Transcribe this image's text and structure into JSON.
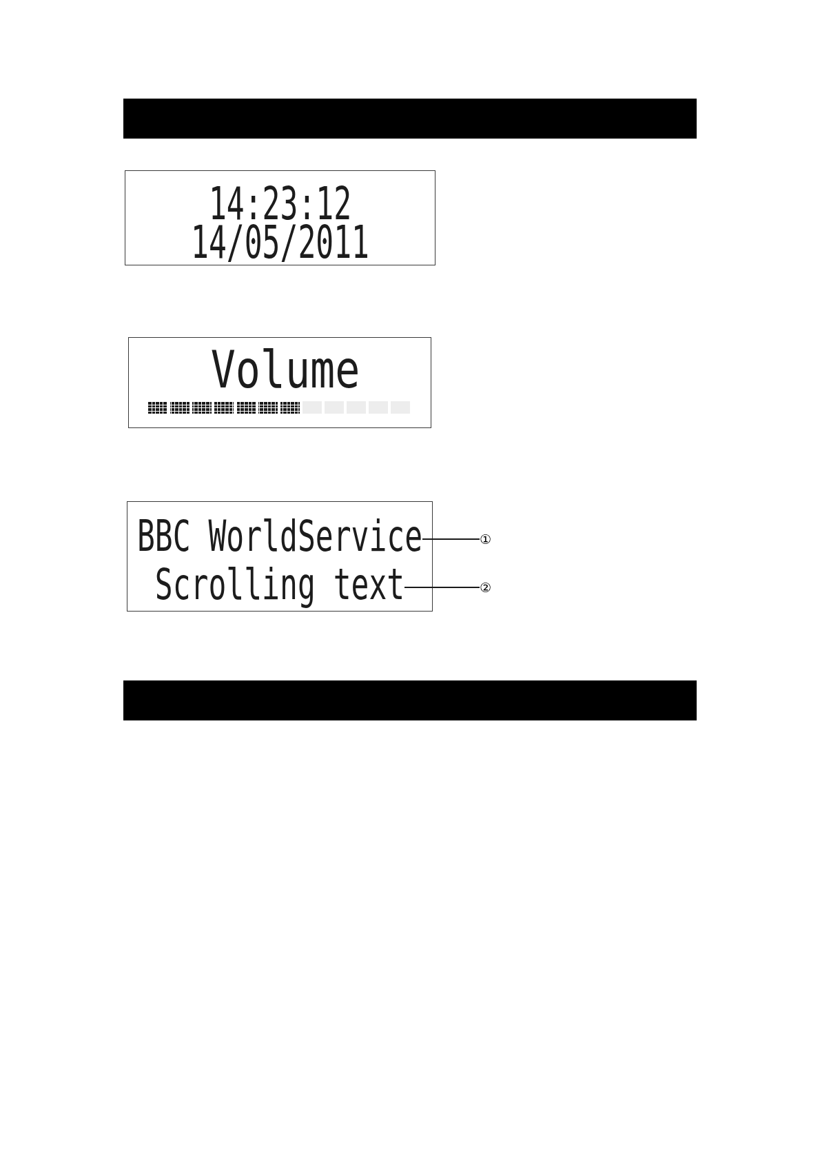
{
  "blocks": [
    {
      "kind": "bar"
    },
    {
      "kind": "display",
      "lines": [
        {
          "text": "14:23:12"
        },
        {
          "text": "14/05/2011"
        }
      ]
    },
    {
      "kind": "display",
      "lines": [
        {
          "text": "Volume"
        }
      ],
      "level_bar": {
        "level": 0.58
      }
    },
    {
      "kind": "display",
      "lines": [
        {
          "text": "BBC WorldService",
          "callout": "①"
        },
        {
          "text": "Scrolling text",
          "callout": "②"
        }
      ]
    },
    {
      "kind": "bar"
    }
  ]
}
